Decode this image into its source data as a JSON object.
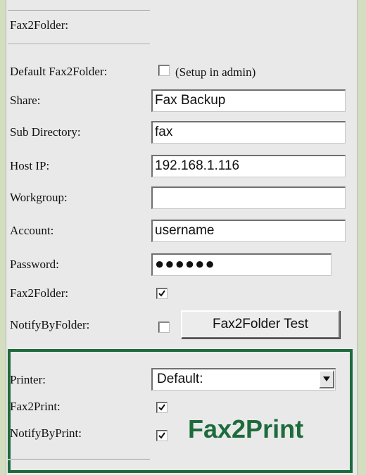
{
  "section_title": "Fax2Folder:",
  "default_fax2folder": {
    "label": "Default Fax2Folder:",
    "checked": false,
    "note": "(Setup in admin)"
  },
  "share": {
    "label": "Share:",
    "value": "Fax Backup"
  },
  "sub_directory": {
    "label": "Sub Directory:",
    "value": "fax"
  },
  "host_ip": {
    "label": "Host IP:",
    "value": "192.168.1.116"
  },
  "workgroup": {
    "label": "Workgroup:",
    "value": ""
  },
  "account": {
    "label": "Account:",
    "value": "username"
  },
  "password": {
    "label": "Password:",
    "value": "●●●●●●"
  },
  "fax2folder": {
    "label": "Fax2Folder:",
    "checked": true
  },
  "notify_by_folder": {
    "label": "NotifyByFolder:",
    "checked": false
  },
  "test_button": {
    "label": "Fax2Folder Test"
  },
  "printer": {
    "label": "Printer:",
    "selected": "Default:"
  },
  "fax2print": {
    "label": "Fax2Print:",
    "checked": true
  },
  "notify_by_print": {
    "label": "NotifyByPrint:",
    "checked": true
  },
  "print_section_title": "Fax2Print",
  "icons": {
    "checkmark": "checkmark-icon",
    "dropdown_arrow": "triangle-down-icon"
  },
  "colors": {
    "background": "#d3dec0",
    "panel": "#e9e9e9",
    "print_box_border": "#1d6b3c",
    "print_title": "#1d6b3c"
  }
}
